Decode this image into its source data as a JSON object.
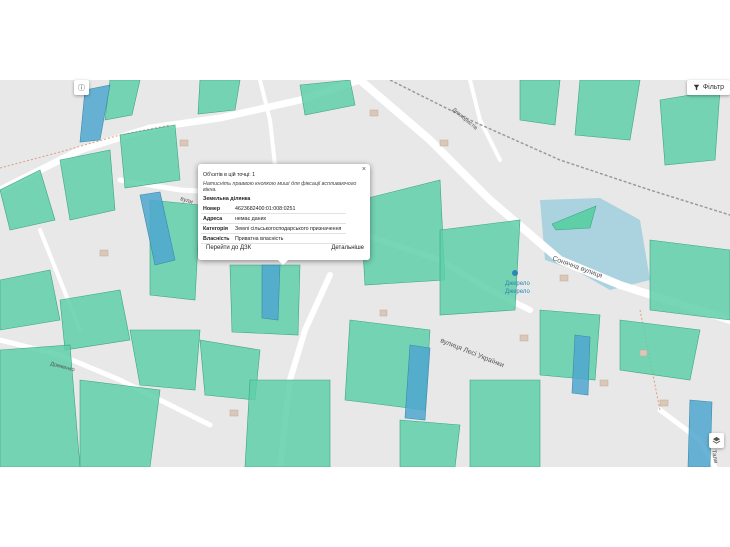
{
  "map": {
    "streets": {
      "soniachna": "Сонячна вулиця",
      "lesi_ukrainky": "вулиця Лесі Українки",
      "vulytsia_partial": "вули",
      "dovzhenka": "Довженко",
      "dekabrystiv": "Декабристів",
      "tallinna_partial": "Тали"
    },
    "poi": {
      "spring_1": "Джерело",
      "spring_2": "Джерело"
    },
    "colors": {
      "parcel": "#5fcfa8",
      "parcel_stroke": "#3aa587",
      "parcel_blue": "#4fa7cf",
      "water": "#aad3df",
      "road": "#ffffff",
      "land": "#e8e8e8"
    }
  },
  "controls": {
    "info_icon": "ⓘ",
    "filter_icon": "filter-icon",
    "filter_label": "Фільтр",
    "layers_icon": "layers-icon"
  },
  "popup": {
    "close": "×",
    "objects_count": "Об'єктів в цій точці: 1",
    "hint": "Натисніть праввою кнопкою миші для фіксації вспливаючого вікна.",
    "section_title": "Земельна ділянка",
    "rows": [
      {
        "key": "Номер",
        "value": "4623682400:01:008:0251"
      },
      {
        "key": "Адреса",
        "value": "немає даних"
      },
      {
        "key": "Категорія",
        "value": "Землі сільськогосподарського призначення"
      },
      {
        "key": "Власність",
        "value": "Приватна власність"
      }
    ],
    "goto_dzk": "Перейти до ДЗК",
    "details": "Детальніше"
  }
}
